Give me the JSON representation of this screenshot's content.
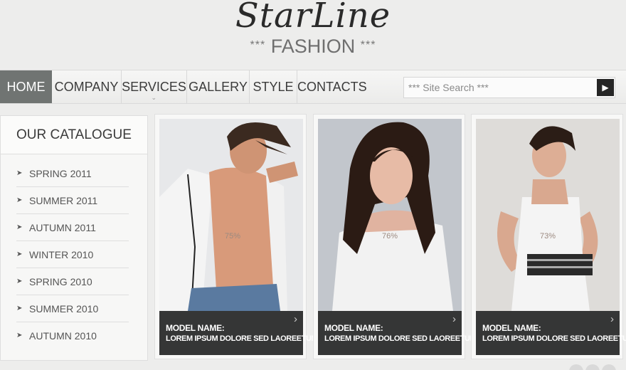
{
  "logo": {
    "main": "StarLine",
    "stars_left": "***",
    "sub": "FASHION",
    "stars_right": "***"
  },
  "nav": {
    "items": [
      {
        "label": "HOME",
        "active": true
      },
      {
        "label": "COMPANY",
        "active": false
      },
      {
        "label": "SERVICES",
        "active": false,
        "has_dropdown": true
      },
      {
        "label": "GALLERY",
        "active": false
      },
      {
        "label": "STYLE",
        "active": false
      },
      {
        "label": "CONTACTS",
        "active": false
      }
    ]
  },
  "search": {
    "placeholder": "*** Site Search ***",
    "button_icon": "arrow-right-icon"
  },
  "sidebar": {
    "title": "OUR CATALOGUE",
    "items": [
      {
        "label": "SPRING 2011"
      },
      {
        "label": "SUMMER 2011"
      },
      {
        "label": "AUTUMN 2011"
      },
      {
        "label": "WINTER 2010"
      },
      {
        "label": "SPRING 2010"
      },
      {
        "label": "SUMMER 2010"
      },
      {
        "label": "AUTUMN 2010"
      }
    ]
  },
  "cards": [
    {
      "name": "MODEL NAME:",
      "desc": "LOREM IPSUM DOLORE SED LAOREETUM",
      "percent": "75%"
    },
    {
      "name": "MODEL NAME:",
      "desc": "LOREM IPSUM DOLORE SED LAOREETUM",
      "percent": "76%"
    },
    {
      "name": "MODEL NAME:",
      "desc": "LOREM IPSUM DOLORE SED LAOREETUM",
      "percent": "73%"
    }
  ],
  "colors": {
    "nav_active_bg": "#707472",
    "caption_bg": "#353636",
    "page_bg": "#ededec"
  }
}
